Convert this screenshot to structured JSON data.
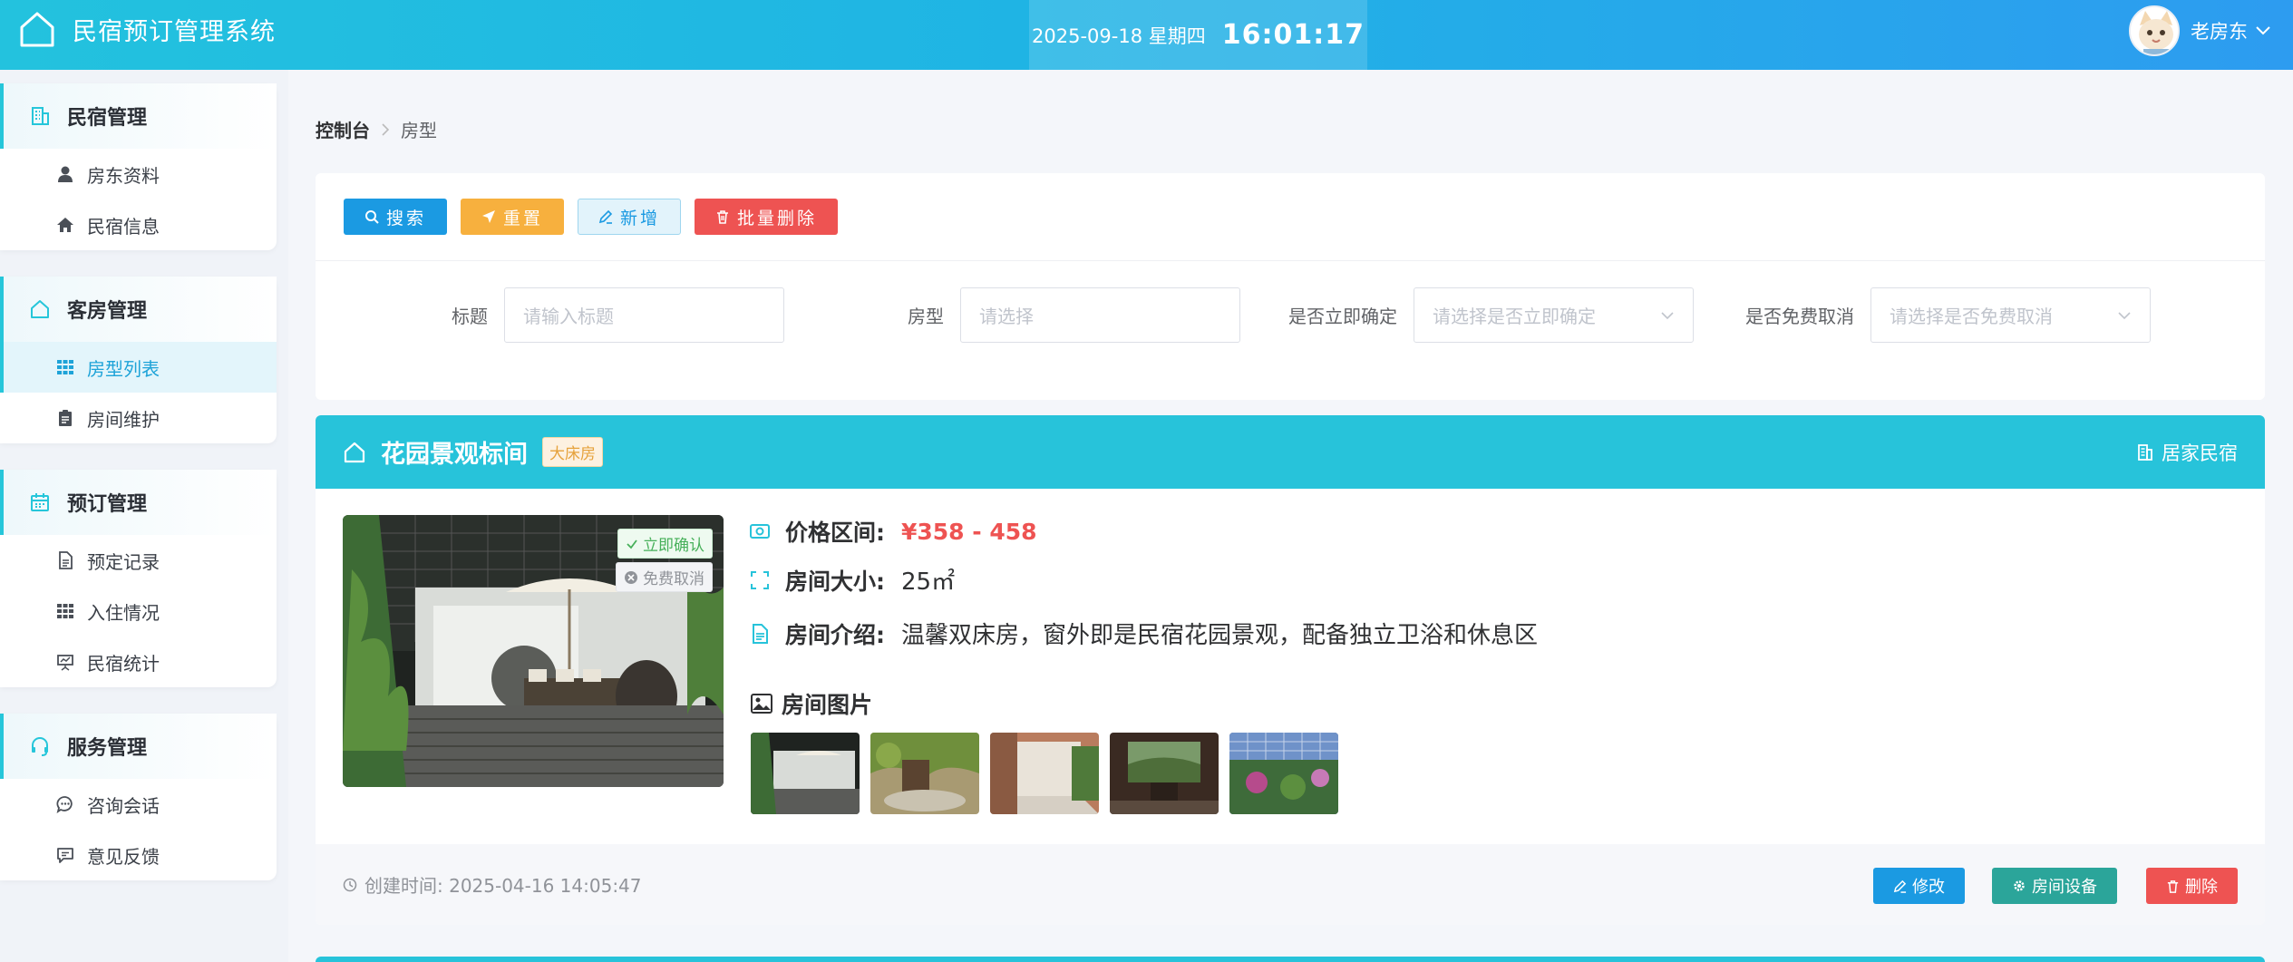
{
  "app": {
    "title": "民宿预订管理系统"
  },
  "clock": {
    "date": "2025-09-18 星期四",
    "time": "16:01:17"
  },
  "user": {
    "name": "老房东"
  },
  "sidebar": {
    "groups": [
      {
        "title": "民宿管理",
        "items": [
          "房东资料",
          "民宿信息"
        ]
      },
      {
        "title": "客房管理",
        "items": [
          "房型列表",
          "房间维护"
        ]
      },
      {
        "title": "预订管理",
        "items": [
          "预定记录",
          "入住情况",
          "民宿统计"
        ]
      },
      {
        "title": "服务管理",
        "items": [
          "咨询会话",
          "意见反馈"
        ]
      }
    ],
    "active_item": "房型列表"
  },
  "breadcrumb": {
    "root": "控制台",
    "current": "房型"
  },
  "toolbar": {
    "search": "搜索",
    "reset": "重置",
    "add": "新增",
    "batch_delete": "批量删除"
  },
  "filters": {
    "title": {
      "label": "标题",
      "placeholder": "请输入标题"
    },
    "room_type": {
      "label": "房型",
      "placeholder": "请选择"
    },
    "instant_confirm": {
      "label": "是否立即确定",
      "placeholder": "请选择是否立即确定"
    },
    "free_cancel": {
      "label": "是否免费取消",
      "placeholder": "请选择是否免费取消"
    }
  },
  "room": {
    "title": "花园景观标间",
    "tag": "大床房",
    "host": "居家民宿",
    "badges": {
      "confirm": "立即确认",
      "cancel": "免费取消"
    },
    "price_label": "价格区间:",
    "price": "¥358 - 458",
    "size_label": "房间大小:",
    "size": "25㎡",
    "intro_label": "房间介绍:",
    "intro": "温馨双床房，窗外即是民宿花园景观，配备独立卫浴和休息区",
    "gallery_title": "房间图片",
    "created": "创建时间: 2025-04-16 14:05:47",
    "actions": {
      "edit": "修改",
      "devices": "房间设备",
      "delete": "删除"
    }
  },
  "icons": [
    "home-icon",
    "clock-icon",
    "building-icon",
    "user-icon",
    "house-icon",
    "grid-icon",
    "clipboard-icon",
    "calendar-icon",
    "document-icon",
    "presentation-icon",
    "headset-icon",
    "chat-icon",
    "message-icon",
    "search-icon",
    "send-icon",
    "pencil-icon",
    "trash-icon",
    "chevron-down-icon",
    "price-icon",
    "expand-icon",
    "image-icon",
    "check-icon",
    "close-circle-icon",
    "gear-icon"
  ],
  "colors": {
    "header": "#23c2de",
    "accent": "#27c3da",
    "primary": "#1b9ae2",
    "warning": "#f7b03e",
    "danger": "#ee5352",
    "teal": "#2ba59a"
  }
}
